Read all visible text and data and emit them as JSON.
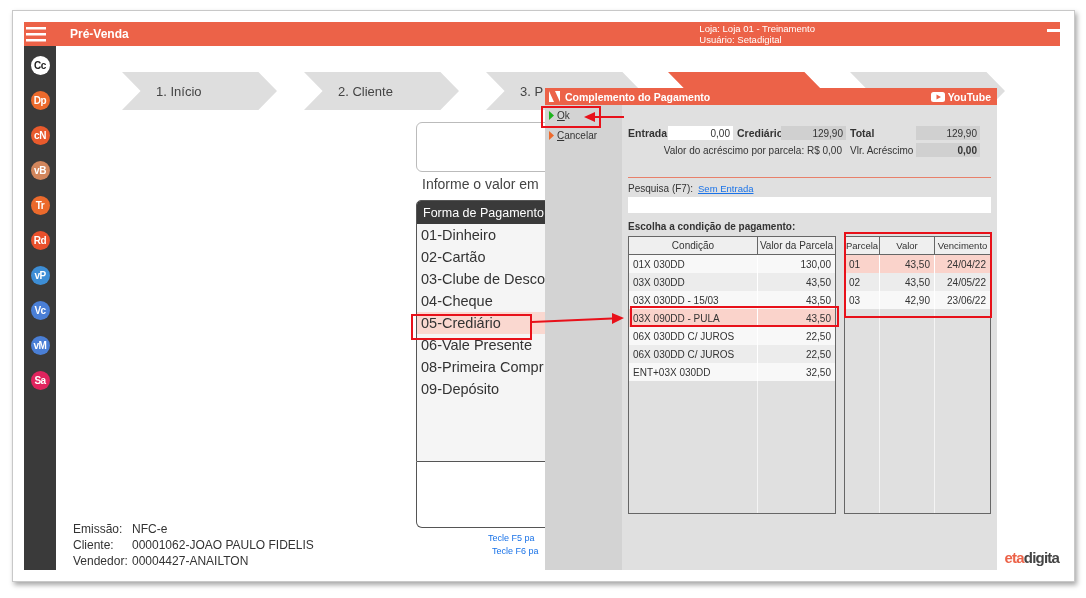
{
  "header": {
    "title": "Pré-Venda",
    "store": "Loja: Loja 01 - Treinamento",
    "user": "Usuário: Setadigital"
  },
  "sidebar": {
    "items": [
      {
        "label": "Cc",
        "color": "#ffffff"
      },
      {
        "label": "Dp",
        "color": "#ec6a2c"
      },
      {
        "label": "cN",
        "color": "#e95a2c"
      },
      {
        "label": "vB",
        "color": "#d2865c"
      },
      {
        "label": "Tr",
        "color": "#ec6a2c"
      },
      {
        "label": "Rd",
        "color": "#e9502c"
      },
      {
        "label": "vP",
        "color": "#3d8ed6"
      },
      {
        "label": "Vc",
        "color": "#4a7fd6"
      },
      {
        "label": "vM",
        "color": "#4a7fd6"
      },
      {
        "label": "Sa",
        "color": "#e0245e"
      }
    ]
  },
  "steps": [
    {
      "label": "1. Início",
      "selected": false
    },
    {
      "label": "2. Cliente",
      "selected": false
    },
    {
      "label": "3. P",
      "selected": false
    },
    {
      "selected": true
    },
    {
      "selected": false
    }
  ],
  "value_prompt": "Informe o valor em",
  "payment_methods": {
    "header": "Forma de Pagamento",
    "items": [
      {
        "label": "01-Dinheiro",
        "selected": false
      },
      {
        "label": "02-Cartão",
        "selected": false
      },
      {
        "label": "03-Clube de Desco",
        "selected": false
      },
      {
        "label": "04-Cheque",
        "selected": false
      },
      {
        "label": "05-Crediário",
        "selected": true
      },
      {
        "label": "06-Vale Presente",
        "selected": false
      },
      {
        "label": "08-Primeira Compr",
        "selected": false
      },
      {
        "label": "09-Depósito",
        "selected": false
      }
    ]
  },
  "hints": [
    "Tecle F5 pa",
    "Tecle F6 pa"
  ],
  "sale_info": [
    {
      "label": "Emissão:",
      "value": "NFC-e"
    },
    {
      "label": "Cliente:",
      "value": "00001062-JOAO PAULO FIDELIS"
    },
    {
      "label": "Vendedor:",
      "value": "00004427-ANAILTON"
    }
  ],
  "logo": {
    "accent": "eta",
    "rest": "digita"
  },
  "dialog": {
    "title": "Complemento do Pagamento",
    "youtube": "YouTube",
    "actions": [
      {
        "label": "Ok",
        "kind": "confirm"
      },
      {
        "label": "Cancelar",
        "kind": "cancel"
      }
    ],
    "fields": {
      "entrada_label": "Entrada",
      "entrada": "0,00",
      "crediario_label": "Crediário",
      "crediario": "129,90",
      "total_label": "Total",
      "total": "129,90",
      "increment_note": "Valor do acréscimo por parcela: R$ 0,00",
      "increment_label": "Vlr. Acréscimo",
      "increment": "0,00"
    },
    "search": {
      "label": "Pesquisa (F7):",
      "link": "Sem Entrada"
    },
    "conditions_title": "Escolha a condição de pagamento:",
    "conditions": {
      "columns": [
        "Condição",
        "Valor da Parcela"
      ],
      "rows": [
        {
          "cells": [
            "01X 030DD",
            "130,00"
          ],
          "selected": false
        },
        {
          "cells": [
            "03X 030DD",
            "43,50"
          ],
          "selected": false
        },
        {
          "cells": [
            "03X 030DD - 15/03",
            "43,50"
          ],
          "selected": false
        },
        {
          "cells": [
            "03X 090DD - PULA",
            "43,50"
          ],
          "selected": true
        },
        {
          "cells": [
            "06X 030DD C/ JUROS",
            "22,50"
          ],
          "selected": false
        },
        {
          "cells": [
            "06X 030DD C/ JUROS",
            "22,50"
          ],
          "selected": false
        },
        {
          "cells": [
            "ENT+03X 030DD",
            "32,50"
          ],
          "selected": false
        }
      ]
    },
    "installments": {
      "columns": [
        "Parcela",
        "Valor",
        "Vencimento"
      ],
      "rows": [
        {
          "cells": [
            "01",
            "43,50",
            "24/04/22"
          ],
          "selected": true
        },
        {
          "cells": [
            "02",
            "43,50",
            "24/05/22"
          ],
          "selected": false
        },
        {
          "cells": [
            "03",
            "42,90",
            "23/06/22"
          ],
          "selected": false
        }
      ]
    }
  }
}
